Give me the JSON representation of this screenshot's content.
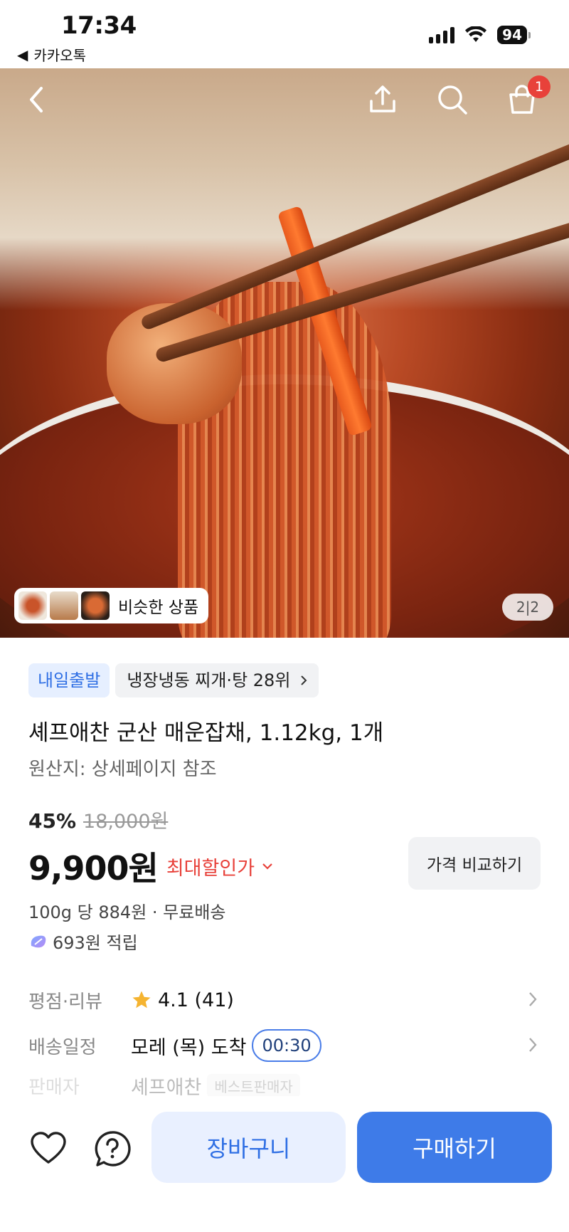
{
  "status_bar": {
    "time": "17:34",
    "back_app": "카카오톡",
    "battery": "94"
  },
  "hero": {
    "cart_count": "1",
    "similar_label": "비슷한 상품",
    "counter": "2|2"
  },
  "product": {
    "tag_delivery": "내일출발",
    "tag_rank": "냉장냉동 찌개·탕 28위",
    "title": "셰프애찬 군산 매운잡채, 1.12kg, 1개",
    "origin": "원산지: 상세페이지 참조",
    "discount_pct": "45%",
    "original_price": "18,000원",
    "price": "9,900원",
    "max_discount": "최대할인가",
    "compare_label": "가격 비교하기",
    "unit_price": "100g 당 884원 · 무료배송",
    "points": "693원 적립"
  },
  "info": {
    "rating_label": "평점·리뷰",
    "rating_value": "4.1 (41)",
    "shipping_label": "배송일정",
    "shipping_value": "모레 (목) 도착",
    "shipping_time": "00:30",
    "seller_label": "판매자",
    "seller_value": "셰프애찬",
    "seller_badge": "베스트판매자"
  },
  "bottom_bar": {
    "cart_label": "장바구니",
    "buy_label": "구매하기"
  },
  "colors": {
    "accent": "#3e7be8",
    "discount_red": "#e8413a",
    "star": "#f5b431"
  }
}
